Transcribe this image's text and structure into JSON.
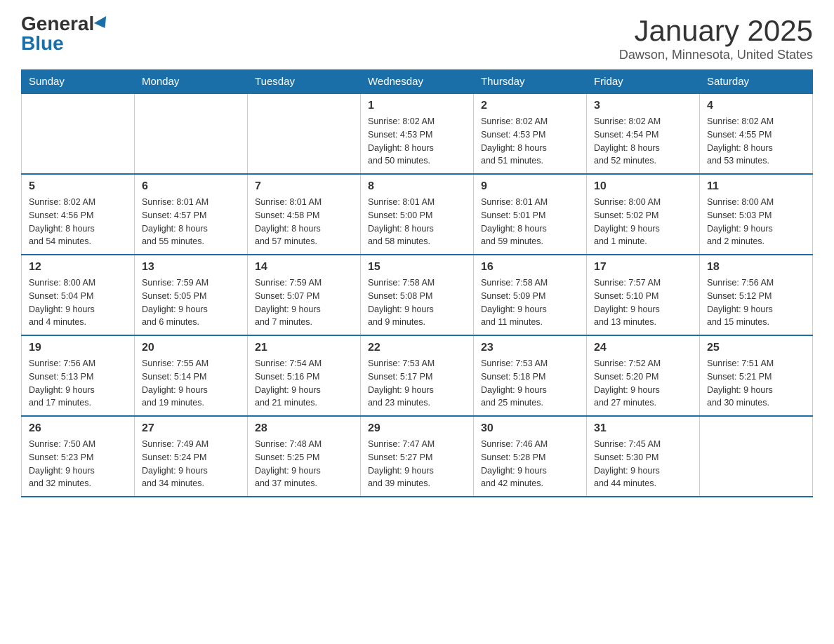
{
  "logo": {
    "general": "General",
    "blue": "Blue"
  },
  "title": "January 2025",
  "location": "Dawson, Minnesota, United States",
  "days_of_week": [
    "Sunday",
    "Monday",
    "Tuesday",
    "Wednesday",
    "Thursday",
    "Friday",
    "Saturday"
  ],
  "weeks": [
    [
      {
        "day": "",
        "info": ""
      },
      {
        "day": "",
        "info": ""
      },
      {
        "day": "",
        "info": ""
      },
      {
        "day": "1",
        "info": "Sunrise: 8:02 AM\nSunset: 4:53 PM\nDaylight: 8 hours\nand 50 minutes."
      },
      {
        "day": "2",
        "info": "Sunrise: 8:02 AM\nSunset: 4:53 PM\nDaylight: 8 hours\nand 51 minutes."
      },
      {
        "day": "3",
        "info": "Sunrise: 8:02 AM\nSunset: 4:54 PM\nDaylight: 8 hours\nand 52 minutes."
      },
      {
        "day": "4",
        "info": "Sunrise: 8:02 AM\nSunset: 4:55 PM\nDaylight: 8 hours\nand 53 minutes."
      }
    ],
    [
      {
        "day": "5",
        "info": "Sunrise: 8:02 AM\nSunset: 4:56 PM\nDaylight: 8 hours\nand 54 minutes."
      },
      {
        "day": "6",
        "info": "Sunrise: 8:01 AM\nSunset: 4:57 PM\nDaylight: 8 hours\nand 55 minutes."
      },
      {
        "day": "7",
        "info": "Sunrise: 8:01 AM\nSunset: 4:58 PM\nDaylight: 8 hours\nand 57 minutes."
      },
      {
        "day": "8",
        "info": "Sunrise: 8:01 AM\nSunset: 5:00 PM\nDaylight: 8 hours\nand 58 minutes."
      },
      {
        "day": "9",
        "info": "Sunrise: 8:01 AM\nSunset: 5:01 PM\nDaylight: 8 hours\nand 59 minutes."
      },
      {
        "day": "10",
        "info": "Sunrise: 8:00 AM\nSunset: 5:02 PM\nDaylight: 9 hours\nand 1 minute."
      },
      {
        "day": "11",
        "info": "Sunrise: 8:00 AM\nSunset: 5:03 PM\nDaylight: 9 hours\nand 2 minutes."
      }
    ],
    [
      {
        "day": "12",
        "info": "Sunrise: 8:00 AM\nSunset: 5:04 PM\nDaylight: 9 hours\nand 4 minutes."
      },
      {
        "day": "13",
        "info": "Sunrise: 7:59 AM\nSunset: 5:05 PM\nDaylight: 9 hours\nand 6 minutes."
      },
      {
        "day": "14",
        "info": "Sunrise: 7:59 AM\nSunset: 5:07 PM\nDaylight: 9 hours\nand 7 minutes."
      },
      {
        "day": "15",
        "info": "Sunrise: 7:58 AM\nSunset: 5:08 PM\nDaylight: 9 hours\nand 9 minutes."
      },
      {
        "day": "16",
        "info": "Sunrise: 7:58 AM\nSunset: 5:09 PM\nDaylight: 9 hours\nand 11 minutes."
      },
      {
        "day": "17",
        "info": "Sunrise: 7:57 AM\nSunset: 5:10 PM\nDaylight: 9 hours\nand 13 minutes."
      },
      {
        "day": "18",
        "info": "Sunrise: 7:56 AM\nSunset: 5:12 PM\nDaylight: 9 hours\nand 15 minutes."
      }
    ],
    [
      {
        "day": "19",
        "info": "Sunrise: 7:56 AM\nSunset: 5:13 PM\nDaylight: 9 hours\nand 17 minutes."
      },
      {
        "day": "20",
        "info": "Sunrise: 7:55 AM\nSunset: 5:14 PM\nDaylight: 9 hours\nand 19 minutes."
      },
      {
        "day": "21",
        "info": "Sunrise: 7:54 AM\nSunset: 5:16 PM\nDaylight: 9 hours\nand 21 minutes."
      },
      {
        "day": "22",
        "info": "Sunrise: 7:53 AM\nSunset: 5:17 PM\nDaylight: 9 hours\nand 23 minutes."
      },
      {
        "day": "23",
        "info": "Sunrise: 7:53 AM\nSunset: 5:18 PM\nDaylight: 9 hours\nand 25 minutes."
      },
      {
        "day": "24",
        "info": "Sunrise: 7:52 AM\nSunset: 5:20 PM\nDaylight: 9 hours\nand 27 minutes."
      },
      {
        "day": "25",
        "info": "Sunrise: 7:51 AM\nSunset: 5:21 PM\nDaylight: 9 hours\nand 30 minutes."
      }
    ],
    [
      {
        "day": "26",
        "info": "Sunrise: 7:50 AM\nSunset: 5:23 PM\nDaylight: 9 hours\nand 32 minutes."
      },
      {
        "day": "27",
        "info": "Sunrise: 7:49 AM\nSunset: 5:24 PM\nDaylight: 9 hours\nand 34 minutes."
      },
      {
        "day": "28",
        "info": "Sunrise: 7:48 AM\nSunset: 5:25 PM\nDaylight: 9 hours\nand 37 minutes."
      },
      {
        "day": "29",
        "info": "Sunrise: 7:47 AM\nSunset: 5:27 PM\nDaylight: 9 hours\nand 39 minutes."
      },
      {
        "day": "30",
        "info": "Sunrise: 7:46 AM\nSunset: 5:28 PM\nDaylight: 9 hours\nand 42 minutes."
      },
      {
        "day": "31",
        "info": "Sunrise: 7:45 AM\nSunset: 5:30 PM\nDaylight: 9 hours\nand 44 minutes."
      },
      {
        "day": "",
        "info": ""
      }
    ]
  ]
}
